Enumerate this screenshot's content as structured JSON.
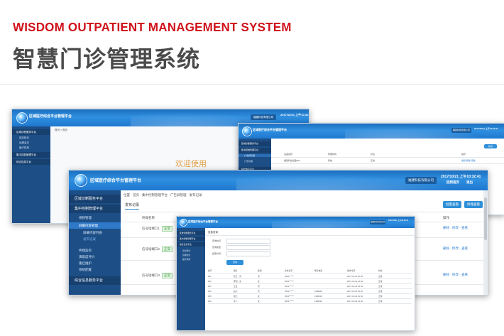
{
  "hero": {
    "title_en": "WISDOM OUTPATIENT MANAGEMENT SYSTEM",
    "title_zh": "智慧门诊管理系统"
  },
  "app": {
    "system_name": "区域医疗综合平台管理平台",
    "datetime": "2017/10/21 上午10:32:41",
    "org_button": "福建科技有限公司",
    "header_link_home": "回到首页",
    "header_link_exit": "退出"
  },
  "w1": {
    "sidebar": [
      "区域诊断服务平台",
      "双向转诊",
      "远程会诊",
      "医疗机构",
      "集中控制管理平台",
      "综合信息平台"
    ],
    "breadcrumb": "首页 > 首页",
    "welcome": "欢迎使用"
  },
  "w2": {
    "sidebar": [
      "区域诊断服务平台",
      "集中控制管理平台",
      "广告屏管理",
      "广告内容",
      "综合信息平台"
    ],
    "add_button": "新增",
    "columns": [
      "设备名称",
      "所属机构",
      "状态",
      "操作"
    ],
    "row": [
      "福建科技设备001",
      "科技",
      "正常",
      "编辑 删除 查看"
    ]
  },
  "w3": {
    "sidebar": {
      "group1": "区域诊断服务平台",
      "group2": "集中控制管理平台",
      "sub_screen": "视频管理",
      "sub_active": "屏幕内容管理",
      "leaves": [
        "屏幕内容列表",
        "发布记录"
      ],
      "more": [
        "终端监控",
        "满意度评价",
        "重启维护",
        "系统配置"
      ],
      "group3": "综合信息服务平台"
    },
    "breadcrumb": [
      "位置",
      "首页",
      "集中控制管理平台",
      "广告屏管理",
      "发布记录"
    ],
    "tab": "发布记录",
    "btn_a": "批量查看",
    "btn_b": "终端查看",
    "table": {
      "header_left": "终端名称",
      "header_right": "操作",
      "rows": [
        {
          "name": "信号墙端口1",
          "status": "正常"
        },
        {
          "name": "信号墙端口2",
          "status": "正常"
        },
        {
          "name": "信号墙端口3",
          "status": "正常"
        }
      ],
      "actions": "删除 · 修改 · 查看"
    }
  },
  "w4": {
    "section": "信息查询",
    "filters": [
      "查询时间",
      "查询类型",
      "结束时间"
    ],
    "search_button": "查询",
    "columns": [
      "编号",
      "姓名",
      "性别",
      "身份证号",
      "联系电话",
      "操作时间",
      "状态"
    ],
    "rows": [
      [
        "001",
        "张三 · 男",
        "男",
        "3501******",
        "",
        "2017-10-21 10:32",
        "正常"
      ],
      [
        "002",
        "李四 · 女",
        "女",
        "3501******",
        "",
        "2017-10-21 10:32",
        "正常"
      ],
      [
        "003",
        "王五",
        "男",
        "3501******",
        "",
        "2017-10-21 10:32",
        "正常"
      ],
      [
        "004",
        "赵六",
        "男",
        "3501******",
        "1380000",
        "2017-10-21 10:32",
        "正常"
      ],
      [
        "005",
        "钱七",
        "女",
        "3501******",
        "1380000",
        "2017-10-21 10:32",
        "正常"
      ],
      [
        "006",
        "孙八",
        "女",
        "3501******",
        "1380000",
        "2017-10-21 10:32",
        "正常"
      ]
    ]
  }
}
